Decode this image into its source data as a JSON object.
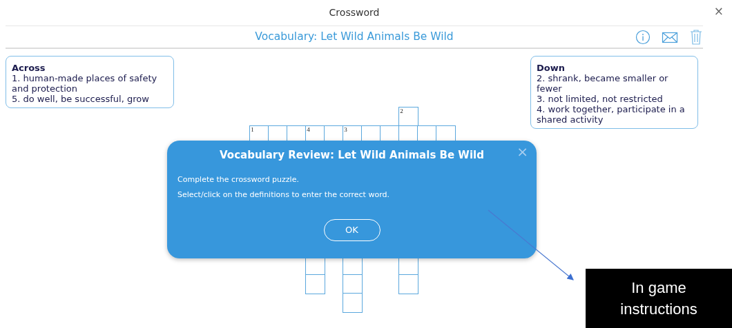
{
  "window": {
    "title": "Crossword",
    "close": "×"
  },
  "header": {
    "title": "Vocabulary: Let Wild Animals Be Wild"
  },
  "across": {
    "heading": "Across",
    "clues": [
      "1. human-made places of safety and protection",
      "5. do well, be successful, grow"
    ]
  },
  "down": {
    "heading": "Down",
    "clues": [
      "2. shrank, became smaller or fewer",
      "3. not limited, not restricted",
      "4. work together, participate in a shared activity"
    ]
  },
  "crossword": {
    "top_rows": [
      {
        "cells": [
          {
            "kind": "gap"
          },
          {
            "kind": "gap"
          },
          {
            "kind": "gap"
          },
          {
            "kind": "gap"
          },
          {
            "kind": "gap"
          },
          {
            "kind": "gap"
          },
          {
            "kind": "gap"
          },
          {
            "kind": "gap"
          },
          {
            "kind": "box",
            "number": "2"
          }
        ]
      },
      {
        "cells": [
          {
            "kind": "box",
            "number": "1"
          },
          {
            "kind": "box"
          },
          {
            "kind": "box"
          },
          {
            "kind": "box",
            "number": "4"
          },
          {
            "kind": "box"
          },
          {
            "kind": "box",
            "number": "3"
          },
          {
            "kind": "box"
          },
          {
            "kind": "box"
          },
          {
            "kind": "box"
          },
          {
            "kind": "box"
          },
          {
            "kind": "box"
          }
        ]
      }
    ],
    "bottom_rows": [
      {
        "cells": [
          {
            "kind": "gap"
          },
          {
            "kind": "gap"
          },
          {
            "kind": "gap"
          },
          {
            "kind": "box"
          },
          {
            "kind": "gap"
          },
          {
            "kind": "box"
          },
          {
            "kind": "gap"
          },
          {
            "kind": "gap"
          },
          {
            "kind": "box"
          }
        ]
      },
      {
        "cells": [
          {
            "kind": "gap"
          },
          {
            "kind": "gap"
          },
          {
            "kind": "gap"
          },
          {
            "kind": "box"
          },
          {
            "kind": "gap"
          },
          {
            "kind": "box"
          },
          {
            "kind": "gap"
          },
          {
            "kind": "gap"
          },
          {
            "kind": "box"
          }
        ]
      },
      {
        "cells": [
          {
            "kind": "gap"
          },
          {
            "kind": "gap"
          },
          {
            "kind": "gap"
          },
          {
            "kind": "gap"
          },
          {
            "kind": "gap"
          },
          {
            "kind": "box"
          }
        ]
      }
    ]
  },
  "dialog": {
    "title": "Vocabulary Review: Let Wild Animals Be Wild",
    "close": "×",
    "lines": [
      "Complete the crossword puzzle.",
      "Select/click on the definitions to enter the correct word."
    ],
    "button": "OK"
  },
  "annotation": {
    "text": "In game instructions"
  }
}
